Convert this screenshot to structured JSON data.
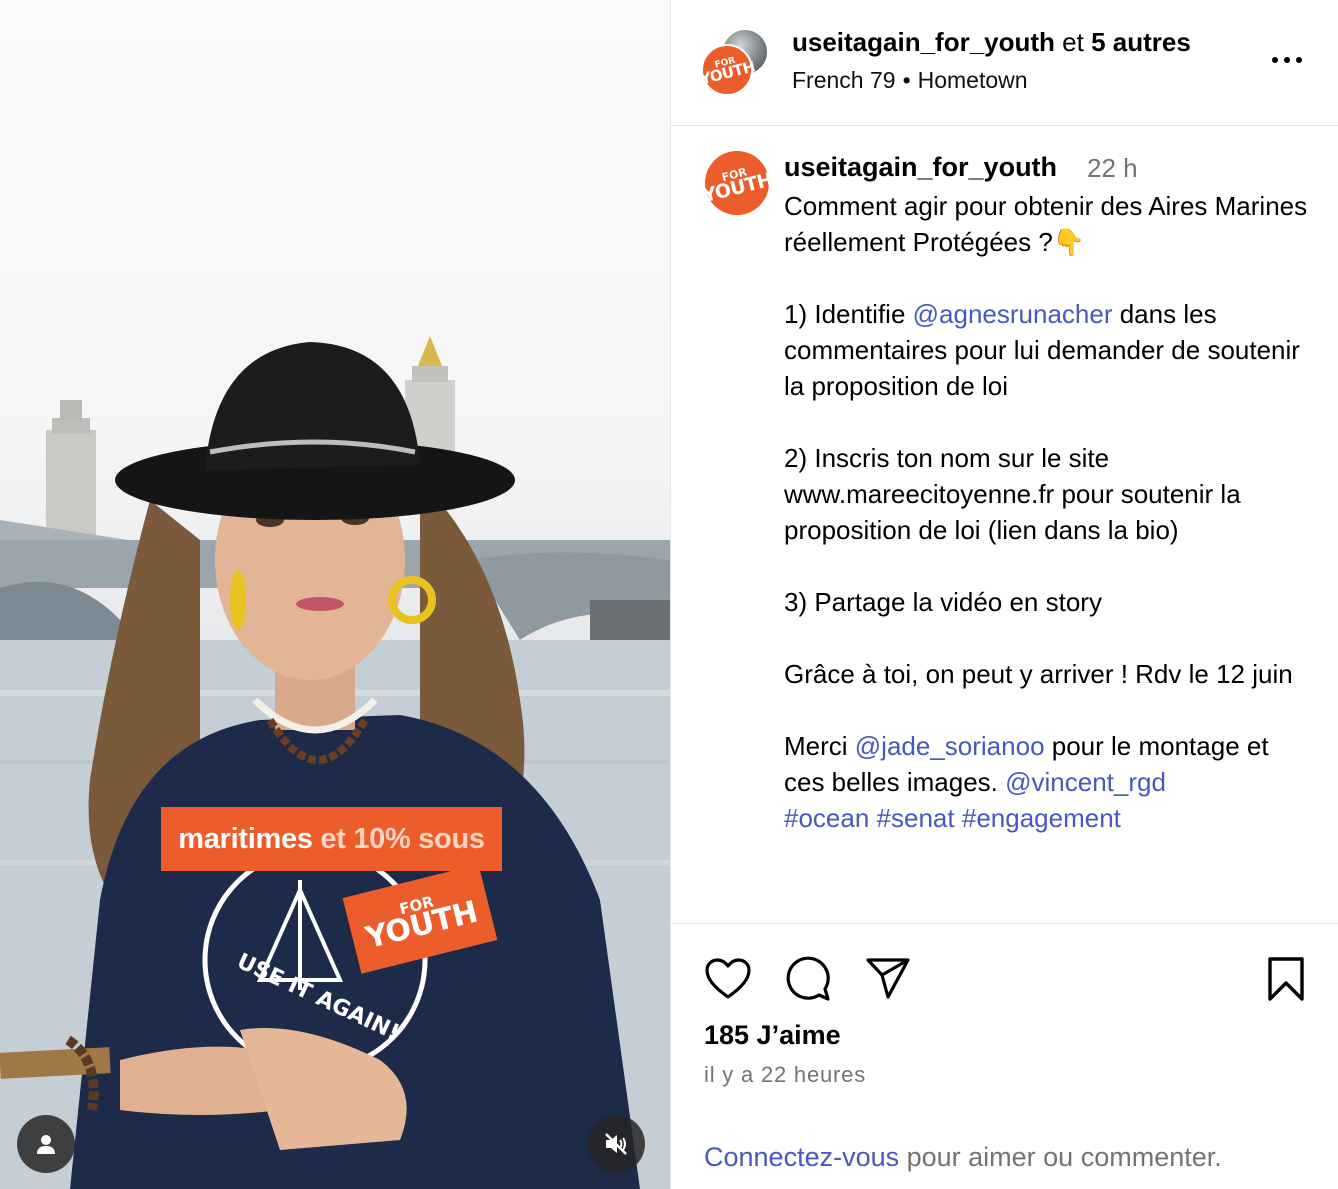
{
  "media": {
    "overlay_caption_strong": "maritimes",
    "overlay_caption_light": "et 10% sous",
    "shirt_badge_for": "FOR",
    "shirt_badge_youth": "YOUTH",
    "shirt_text": "USE IT AGAIN!",
    "user_button_icon": "person-icon",
    "mute_button_icon": "speaker-muted-icon"
  },
  "header": {
    "username": "useitagain_for_youth",
    "connector": " et ",
    "others": "5 autres",
    "audio": "French 79",
    "separator": "•",
    "audio_track": "Hometown",
    "avatar_logo_for": "FOR",
    "avatar_logo_youth": "YOUTH",
    "more_icon": "more-horizontal-icon"
  },
  "comment": {
    "username": "useitagain_for_youth",
    "time": "22 h",
    "line1": "Comment agir pour obtenir des Aires Marines réellement Protégées ?👇",
    "p1_before": "1) Identifie ",
    "p1_mention": "@agnesrunacher",
    "p1_after": " dans les commentaires pour lui demander de soutenir la proposition de loi",
    "p2": "2) Inscris ton nom sur le site www.mareecitoyenne.fr pour soutenir la proposition de loi (lien dans la bio)",
    "p3": "3) Partage la vidéo en story",
    "p4": "Grâce à toi, on peut y arriver ! Rdv le 12 juin",
    "p5_before": "Merci ",
    "p5_mention1": "@jade_sorianoo",
    "p5_mid": " pour le montage et ces belles images. ",
    "p5_mention2": "@vincent_rgd",
    "p5_tag1": "#ocean",
    "p5_tag2": "#senat",
    "p5_tag3": "#engagement",
    "avatar_logo_for": "FOR",
    "avatar_logo_youth": "YOUTH"
  },
  "actions": {
    "like_icon": "heart-icon",
    "comment_icon": "comment-bubble-icon",
    "share_icon": "paper-plane-icon",
    "save_icon": "bookmark-icon",
    "likes": "185 J’aime",
    "time_ago": "il y a 22 heures",
    "login_link": "Connectez-vous",
    "login_text": " pour aimer ou commenter."
  },
  "colors": {
    "brand_orange": "#ec5d2b",
    "link_blue": "#4658c1",
    "muted_gray": "#737373"
  }
}
